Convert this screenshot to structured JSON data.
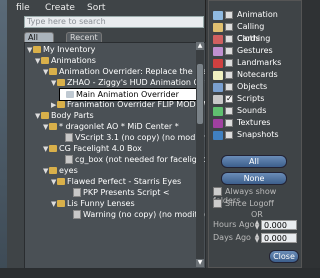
{
  "menu": {
    "file": "file",
    "create": "Create",
    "sort": "Sort"
  },
  "search": {
    "placeholder": "Type here to search"
  },
  "tabs": [
    {
      "label": "All Items"
    },
    {
      "label": "Recent Items"
    }
  ],
  "tree": [
    {
      "label": "My Inventory",
      "icon": "folder"
    },
    {
      "label": "Animations",
      "icon": "folder"
    },
    {
      "label": "Animation Overrider: Replace the Default Ani",
      "icon": "folder"
    },
    {
      "label": "ZHAO - Ziggy's HUD Animation Overrider",
      "icon": "folder"
    },
    {
      "label": "Main Animation Overrider",
      "icon": "anim"
    },
    {
      "label": "Franimation Overrider FLIP MOD - WAY",
      "icon": "folder"
    },
    {
      "label": "Body Parts",
      "icon": "folder"
    },
    {
      "label": "* dragonlet AO * MiD Center *",
      "icon": "folder"
    },
    {
      "label": "VScript 3.1 (no copy) (no modify)",
      "icon": "script"
    },
    {
      "label": "CG Facelight 4.0 Box",
      "icon": "folder"
    },
    {
      "label": "cg_box (not needed for facelight)",
      "icon": "script"
    },
    {
      "label": "eyes",
      "icon": "folder"
    },
    {
      "label": "Flawed Perfect - Starris Eyes",
      "icon": "folder"
    },
    {
      "label": "PKP Presents Script <",
      "icon": "script"
    },
    {
      "label": "Lis Funny Lenses",
      "icon": "folder"
    },
    {
      "label": "Warning (no copy) (no modify)",
      "icon": "script"
    }
  ],
  "filters": [
    {
      "label": "Animation",
      "checked": false,
      "color": "#8fb9e0"
    },
    {
      "label": "Calling Cards",
      "checked": false,
      "color": "#e0c070"
    },
    {
      "label": "Clothing",
      "checked": false,
      "color": "#d06060"
    },
    {
      "label": "Gestures",
      "checked": false,
      "color": "#c090d0"
    },
    {
      "label": "Landmarks",
      "checked": false,
      "color": "#d04040"
    },
    {
      "label": "Notecards",
      "checked": false,
      "color": "#f0f0c0"
    },
    {
      "label": "Objects",
      "checked": false,
      "color": "#7aa0d0"
    },
    {
      "label": "Scripts",
      "checked": true,
      "color": "#c8c8c8"
    },
    {
      "label": "Sounds",
      "checked": false,
      "color": "#60c070"
    },
    {
      "label": "Textures",
      "checked": false,
      "color": "#a040a0"
    },
    {
      "label": "Snapshots",
      "checked": false,
      "color": "#4080c0"
    }
  ],
  "buttons": {
    "all": "All",
    "none": "None",
    "close": "Close"
  },
  "options": {
    "always_show_folders": "Always show folders",
    "since_logoff": "Since Logoff",
    "or": "OR",
    "hours_ago": "Hours Ago",
    "days_ago": "Days Ago",
    "hours_value": "0.000",
    "days_value": "0.000"
  }
}
